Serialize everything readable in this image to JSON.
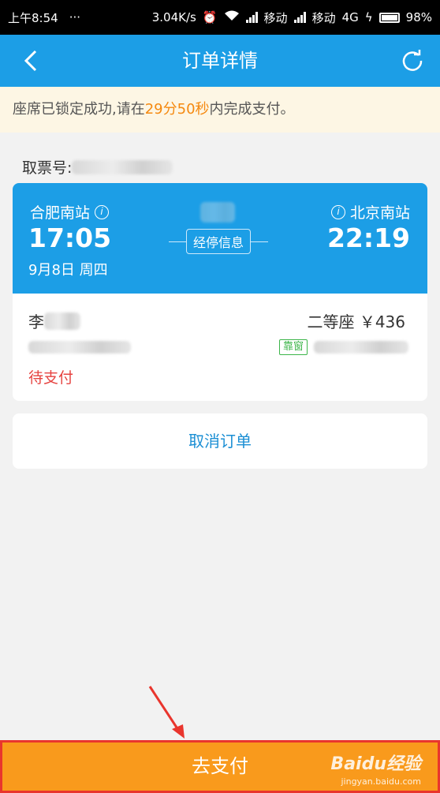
{
  "status_bar": {
    "time": "上午8:54",
    "speed": "3.04K/s",
    "carrier1": "移动",
    "carrier2": "移动",
    "network": "4G",
    "battery": "98%"
  },
  "nav": {
    "title": "订单详情",
    "back_icon": "chevron-left-icon",
    "refresh_icon": "refresh-icon"
  },
  "notice": {
    "prefix": "座席已锁定成功,请在",
    "countdown": "29分50秒",
    "suffix": "内完成支付。"
  },
  "ticket_number_label": "取票号:",
  "trip": {
    "from_station": "合肥南站",
    "to_station": "北京南站",
    "depart_time": "17:05",
    "arrive_time": "22:19",
    "date": "9月8日 周四",
    "stops_label": "经停信息"
  },
  "passenger": {
    "name": "李",
    "seat": "二等座 ￥436",
    "window_tag": "靠窗",
    "status": "待支付"
  },
  "cancel_label": "取消订单",
  "pay_label": "去支付",
  "watermark": {
    "brand": "Baidu经验",
    "url": "jingyan.baidu.com"
  },
  "colors": {
    "primary": "#1c9ee6",
    "accent": "#f5890f",
    "pay": "#f99a1c",
    "danger": "#e64340"
  }
}
